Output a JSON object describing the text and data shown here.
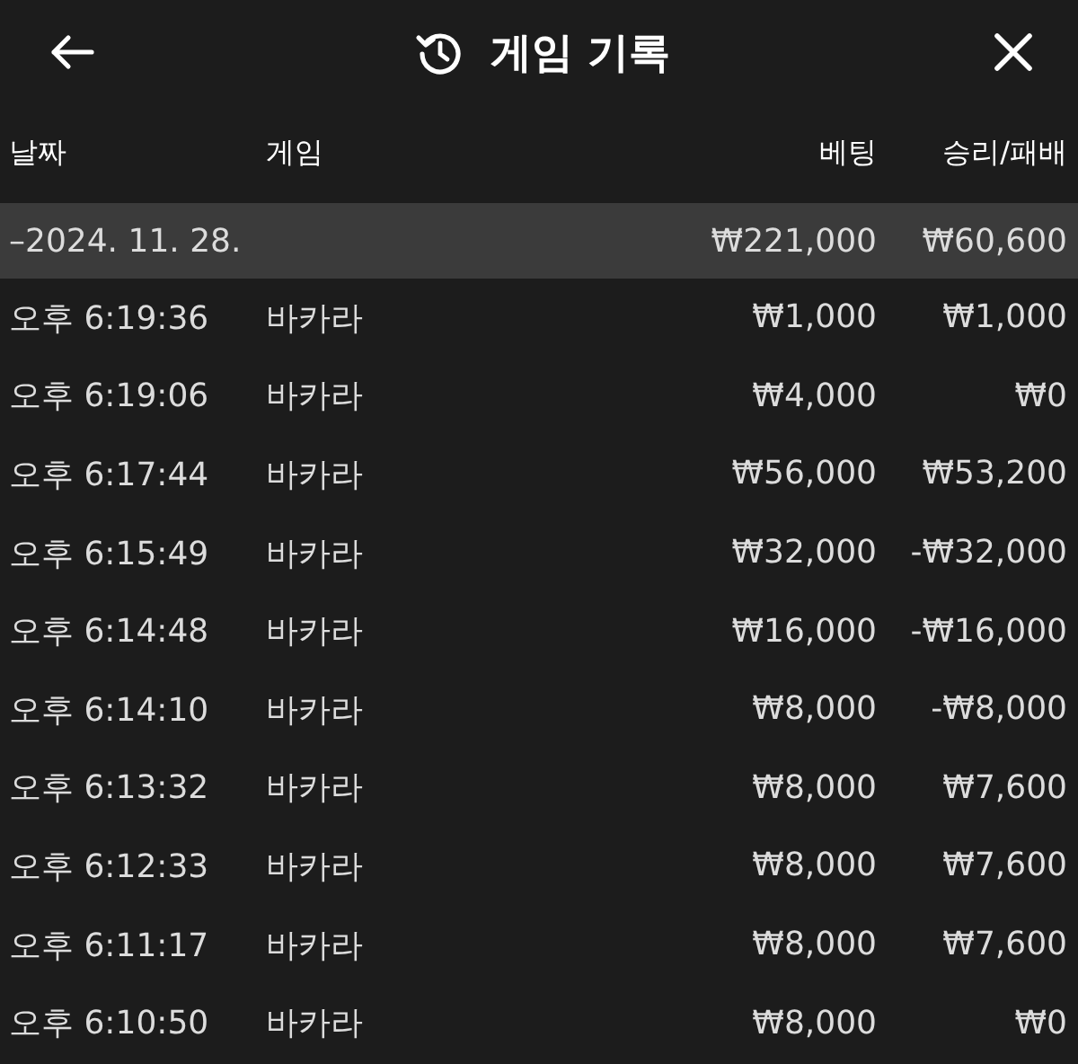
{
  "header": {
    "title": "게임 기록"
  },
  "columns": [
    "날짜",
    "게임",
    "베팅",
    "승리/패배"
  ],
  "group": {
    "date": "–2024. 11. 28.",
    "bet": "₩221,000",
    "result": "₩60,600"
  },
  "rows": [
    {
      "time": "오후 6:19:36",
      "game": "바카라",
      "bet": "₩1,000",
      "result": "₩1,000"
    },
    {
      "time": "오후 6:19:06",
      "game": "바카라",
      "bet": "₩4,000",
      "result": "₩0"
    },
    {
      "time": "오후 6:17:44",
      "game": "바카라",
      "bet": "₩56,000",
      "result": "₩53,200"
    },
    {
      "time": "오후 6:15:49",
      "game": "바카라",
      "bet": "₩32,000",
      "result": "-₩32,000"
    },
    {
      "time": "오후 6:14:48",
      "game": "바카라",
      "bet": "₩16,000",
      "result": "-₩16,000"
    },
    {
      "time": "오후 6:14:10",
      "game": "바카라",
      "bet": "₩8,000",
      "result": "-₩8,000"
    },
    {
      "time": "오후 6:13:32",
      "game": "바카라",
      "bet": "₩8,000",
      "result": "₩7,600"
    },
    {
      "time": "오후 6:12:33",
      "game": "바카라",
      "bet": "₩8,000",
      "result": "₩7,600"
    },
    {
      "time": "오후 6:11:17",
      "game": "바카라",
      "bet": "₩8,000",
      "result": "₩7,600"
    },
    {
      "time": "오후 6:10:50",
      "game": "바카라",
      "bet": "₩8,000",
      "result": "₩0"
    }
  ]
}
